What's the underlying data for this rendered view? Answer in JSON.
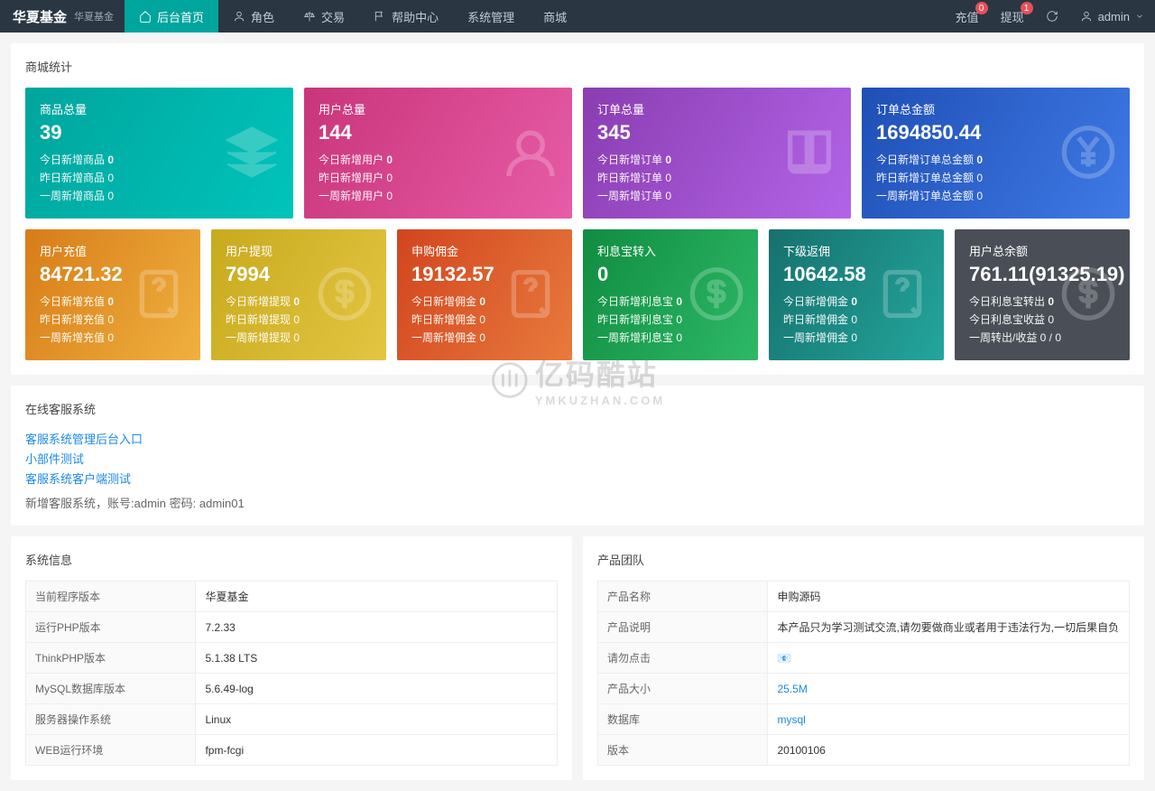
{
  "header": {
    "brand": "华夏基金",
    "brand_sub": "华夏基金",
    "tabs": [
      {
        "label": "后台首页",
        "active": true,
        "icon": "home"
      },
      {
        "label": "角色",
        "icon": "user"
      },
      {
        "label": "交易",
        "icon": "scale"
      },
      {
        "label": "帮助中心",
        "icon": "flag"
      },
      {
        "label": "系统管理"
      },
      {
        "label": "商城"
      }
    ],
    "actions": {
      "recharge": {
        "label": "充值",
        "badge": "0"
      },
      "withdraw": {
        "label": "提现",
        "badge": "1"
      },
      "user": "admin"
    }
  },
  "stats_title": "商城统计",
  "row1": [
    {
      "title": "商品总量",
      "num": "39",
      "l1": "今日新增商品",
      "v1": "0",
      "l2": "昨日新增商品",
      "v2": "0",
      "l3": "一周新增商品",
      "v3": "0",
      "class": "g-teal",
      "icon": "layers"
    },
    {
      "title": "用户总量",
      "num": "144",
      "l1": "今日新增用户",
      "v1": "0",
      "l2": "昨日新增用户",
      "v2": "0",
      "l3": "一周新增用户",
      "v3": "0",
      "class": "g-pink",
      "icon": "user"
    },
    {
      "title": "订单总量",
      "num": "345",
      "l1": "今日新增订单",
      "v1": "0",
      "l2": "昨日新增订单",
      "v2": "0",
      "l3": "一周新增订单",
      "v3": "0",
      "class": "g-purple",
      "icon": "book"
    },
    {
      "title": "订单总金额",
      "num": "1694850.44",
      "l1": "今日新增订单总金额",
      "v1": "0",
      "l2": "昨日新增订单总金额",
      "v2": "0",
      "l3": "一周新增订单总金额",
      "v3": "0",
      "class": "g-blue",
      "icon": "yen"
    }
  ],
  "row2": [
    {
      "title": "用户充值",
      "num": "84721.32",
      "l1": "今日新增充值",
      "v1": "0",
      "l2": "昨日新增充值",
      "v2": "0",
      "l3": "一周新增充值",
      "v3": "0",
      "class": "g-orange",
      "icon": "docq"
    },
    {
      "title": "用户提现",
      "num": "7994",
      "l1": "今日新增提现",
      "v1": "0",
      "l2": "昨日新增提现",
      "v2": "0",
      "l3": "一周新增提现",
      "v3": "0",
      "class": "g-yellow",
      "icon": "dollar"
    },
    {
      "title": "申购佣金",
      "num": "19132.57",
      "l1": "今日新增佣金",
      "v1": "0",
      "l2": "昨日新增佣金",
      "v2": "0",
      "l3": "一周新增佣金",
      "v3": "0",
      "class": "g-redorange",
      "icon": "docq"
    },
    {
      "title": "利息宝转入",
      "num": "0",
      "l1": "今日新增利息宝",
      "v1": "0",
      "l2": "昨日新增利息宝",
      "v2": "0",
      "l3": "一周新增利息宝",
      "v3": "0",
      "class": "g-green",
      "icon": "dollar"
    },
    {
      "title": "下级返佣",
      "num": "10642.58",
      "l1": "今日新增佣金",
      "v1": "0",
      "l2": "昨日新增佣金",
      "v2": "0",
      "l3": "一周新增佣金",
      "v3": "0",
      "class": "g-darkteal",
      "icon": "docq"
    },
    {
      "title": "用户总余额",
      "num": "761.11(91325.19)",
      "l1": "今日利息宝转出",
      "v1": "0",
      "l2": "今日利息宝收益",
      "v2": "0",
      "l3": "一周转出/收益",
      "v3": "0 / 0",
      "class": "g-gray",
      "icon": "dollar"
    }
  ],
  "kf": {
    "title": "在线客服系统",
    "links": [
      "客服系统管理后台入口",
      "小部件测试",
      "客服系统客户端测试"
    ],
    "note": "新增客服系统，账号:admin 密码: admin01"
  },
  "sysinfo": {
    "title": "系统信息",
    "rows": [
      [
        "当前程序版本",
        "华夏基金"
      ],
      [
        "运行PHP版本",
        "7.2.33"
      ],
      [
        "ThinkPHP版本",
        "5.1.38 LTS"
      ],
      [
        "MySQL数据库版本",
        "5.6.49-log"
      ],
      [
        "服务器操作系统",
        "Linux"
      ],
      [
        "WEB运行环境",
        "fpm-fcgi"
      ]
    ]
  },
  "team": {
    "title": "产品团队",
    "rows": [
      [
        "产品名称",
        "申购源码",
        false
      ],
      [
        "产品说明",
        "本产品只为学习测试交流,请勿要做商业或者用于违法行为,一切后果自负",
        false
      ],
      [
        "请勿点击",
        "📧",
        false
      ],
      [
        "产品大小",
        "25.5M",
        true
      ],
      [
        "数据库",
        "mysql",
        true
      ],
      [
        "版本",
        "20100106",
        false
      ]
    ]
  },
  "watermark": {
    "main": "亿码酷站",
    "sub": "YMKUZHAN.COM"
  }
}
